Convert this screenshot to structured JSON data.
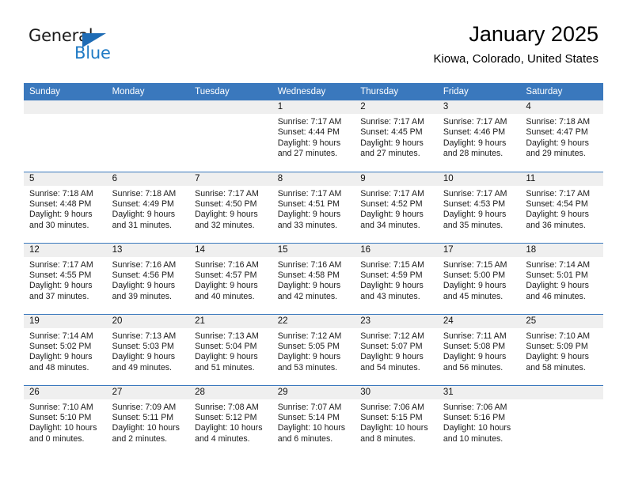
{
  "brand": {
    "name_part1": "General",
    "name_part2": "Blue",
    "triangle_color": "#1f6cb5",
    "blue_color": "#1f7ac4"
  },
  "header": {
    "title": "January 2025",
    "subtitle": "Kiowa, Colorado, United States",
    "header_bg": "#3a78bd",
    "daynum_bg": "#efefef"
  },
  "weekdays": [
    "Sunday",
    "Monday",
    "Tuesday",
    "Wednesday",
    "Thursday",
    "Friday",
    "Saturday"
  ],
  "weeks": [
    [
      {
        "day": "",
        "sunrise": "",
        "sunset": "",
        "daylight_line1": "",
        "daylight_line2": ""
      },
      {
        "day": "",
        "sunrise": "",
        "sunset": "",
        "daylight_line1": "",
        "daylight_line2": ""
      },
      {
        "day": "",
        "sunrise": "",
        "sunset": "",
        "daylight_line1": "",
        "daylight_line2": ""
      },
      {
        "day": "1",
        "sunrise": "Sunrise: 7:17 AM",
        "sunset": "Sunset: 4:44 PM",
        "daylight_line1": "Daylight: 9 hours",
        "daylight_line2": "and 27 minutes."
      },
      {
        "day": "2",
        "sunrise": "Sunrise: 7:17 AM",
        "sunset": "Sunset: 4:45 PM",
        "daylight_line1": "Daylight: 9 hours",
        "daylight_line2": "and 27 minutes."
      },
      {
        "day": "3",
        "sunrise": "Sunrise: 7:17 AM",
        "sunset": "Sunset: 4:46 PM",
        "daylight_line1": "Daylight: 9 hours",
        "daylight_line2": "and 28 minutes."
      },
      {
        "day": "4",
        "sunrise": "Sunrise: 7:18 AM",
        "sunset": "Sunset: 4:47 PM",
        "daylight_line1": "Daylight: 9 hours",
        "daylight_line2": "and 29 minutes."
      }
    ],
    [
      {
        "day": "5",
        "sunrise": "Sunrise: 7:18 AM",
        "sunset": "Sunset: 4:48 PM",
        "daylight_line1": "Daylight: 9 hours",
        "daylight_line2": "and 30 minutes."
      },
      {
        "day": "6",
        "sunrise": "Sunrise: 7:18 AM",
        "sunset": "Sunset: 4:49 PM",
        "daylight_line1": "Daylight: 9 hours",
        "daylight_line2": "and 31 minutes."
      },
      {
        "day": "7",
        "sunrise": "Sunrise: 7:17 AM",
        "sunset": "Sunset: 4:50 PM",
        "daylight_line1": "Daylight: 9 hours",
        "daylight_line2": "and 32 minutes."
      },
      {
        "day": "8",
        "sunrise": "Sunrise: 7:17 AM",
        "sunset": "Sunset: 4:51 PM",
        "daylight_line1": "Daylight: 9 hours",
        "daylight_line2": "and 33 minutes."
      },
      {
        "day": "9",
        "sunrise": "Sunrise: 7:17 AM",
        "sunset": "Sunset: 4:52 PM",
        "daylight_line1": "Daylight: 9 hours",
        "daylight_line2": "and 34 minutes."
      },
      {
        "day": "10",
        "sunrise": "Sunrise: 7:17 AM",
        "sunset": "Sunset: 4:53 PM",
        "daylight_line1": "Daylight: 9 hours",
        "daylight_line2": "and 35 minutes."
      },
      {
        "day": "11",
        "sunrise": "Sunrise: 7:17 AM",
        "sunset": "Sunset: 4:54 PM",
        "daylight_line1": "Daylight: 9 hours",
        "daylight_line2": "and 36 minutes."
      }
    ],
    [
      {
        "day": "12",
        "sunrise": "Sunrise: 7:17 AM",
        "sunset": "Sunset: 4:55 PM",
        "daylight_line1": "Daylight: 9 hours",
        "daylight_line2": "and 37 minutes."
      },
      {
        "day": "13",
        "sunrise": "Sunrise: 7:16 AM",
        "sunset": "Sunset: 4:56 PM",
        "daylight_line1": "Daylight: 9 hours",
        "daylight_line2": "and 39 minutes."
      },
      {
        "day": "14",
        "sunrise": "Sunrise: 7:16 AM",
        "sunset": "Sunset: 4:57 PM",
        "daylight_line1": "Daylight: 9 hours",
        "daylight_line2": "and 40 minutes."
      },
      {
        "day": "15",
        "sunrise": "Sunrise: 7:16 AM",
        "sunset": "Sunset: 4:58 PM",
        "daylight_line1": "Daylight: 9 hours",
        "daylight_line2": "and 42 minutes."
      },
      {
        "day": "16",
        "sunrise": "Sunrise: 7:15 AM",
        "sunset": "Sunset: 4:59 PM",
        "daylight_line1": "Daylight: 9 hours",
        "daylight_line2": "and 43 minutes."
      },
      {
        "day": "17",
        "sunrise": "Sunrise: 7:15 AM",
        "sunset": "Sunset: 5:00 PM",
        "daylight_line1": "Daylight: 9 hours",
        "daylight_line2": "and 45 minutes."
      },
      {
        "day": "18",
        "sunrise": "Sunrise: 7:14 AM",
        "sunset": "Sunset: 5:01 PM",
        "daylight_line1": "Daylight: 9 hours",
        "daylight_line2": "and 46 minutes."
      }
    ],
    [
      {
        "day": "19",
        "sunrise": "Sunrise: 7:14 AM",
        "sunset": "Sunset: 5:02 PM",
        "daylight_line1": "Daylight: 9 hours",
        "daylight_line2": "and 48 minutes."
      },
      {
        "day": "20",
        "sunrise": "Sunrise: 7:13 AM",
        "sunset": "Sunset: 5:03 PM",
        "daylight_line1": "Daylight: 9 hours",
        "daylight_line2": "and 49 minutes."
      },
      {
        "day": "21",
        "sunrise": "Sunrise: 7:13 AM",
        "sunset": "Sunset: 5:04 PM",
        "daylight_line1": "Daylight: 9 hours",
        "daylight_line2": "and 51 minutes."
      },
      {
        "day": "22",
        "sunrise": "Sunrise: 7:12 AM",
        "sunset": "Sunset: 5:05 PM",
        "daylight_line1": "Daylight: 9 hours",
        "daylight_line2": "and 53 minutes."
      },
      {
        "day": "23",
        "sunrise": "Sunrise: 7:12 AM",
        "sunset": "Sunset: 5:07 PM",
        "daylight_line1": "Daylight: 9 hours",
        "daylight_line2": "and 54 minutes."
      },
      {
        "day": "24",
        "sunrise": "Sunrise: 7:11 AM",
        "sunset": "Sunset: 5:08 PM",
        "daylight_line1": "Daylight: 9 hours",
        "daylight_line2": "and 56 minutes."
      },
      {
        "day": "25",
        "sunrise": "Sunrise: 7:10 AM",
        "sunset": "Sunset: 5:09 PM",
        "daylight_line1": "Daylight: 9 hours",
        "daylight_line2": "and 58 minutes."
      }
    ],
    [
      {
        "day": "26",
        "sunrise": "Sunrise: 7:10 AM",
        "sunset": "Sunset: 5:10 PM",
        "daylight_line1": "Daylight: 10 hours",
        "daylight_line2": "and 0 minutes."
      },
      {
        "day": "27",
        "sunrise": "Sunrise: 7:09 AM",
        "sunset": "Sunset: 5:11 PM",
        "daylight_line1": "Daylight: 10 hours",
        "daylight_line2": "and 2 minutes."
      },
      {
        "day": "28",
        "sunrise": "Sunrise: 7:08 AM",
        "sunset": "Sunset: 5:12 PM",
        "daylight_line1": "Daylight: 10 hours",
        "daylight_line2": "and 4 minutes."
      },
      {
        "day": "29",
        "sunrise": "Sunrise: 7:07 AM",
        "sunset": "Sunset: 5:14 PM",
        "daylight_line1": "Daylight: 10 hours",
        "daylight_line2": "and 6 minutes."
      },
      {
        "day": "30",
        "sunrise": "Sunrise: 7:06 AM",
        "sunset": "Sunset: 5:15 PM",
        "daylight_line1": "Daylight: 10 hours",
        "daylight_line2": "and 8 minutes."
      },
      {
        "day": "31",
        "sunrise": "Sunrise: 7:06 AM",
        "sunset": "Sunset: 5:16 PM",
        "daylight_line1": "Daylight: 10 hours",
        "daylight_line2": "and 10 minutes."
      },
      {
        "day": "",
        "sunrise": "",
        "sunset": "",
        "daylight_line1": "",
        "daylight_line2": ""
      }
    ]
  ]
}
